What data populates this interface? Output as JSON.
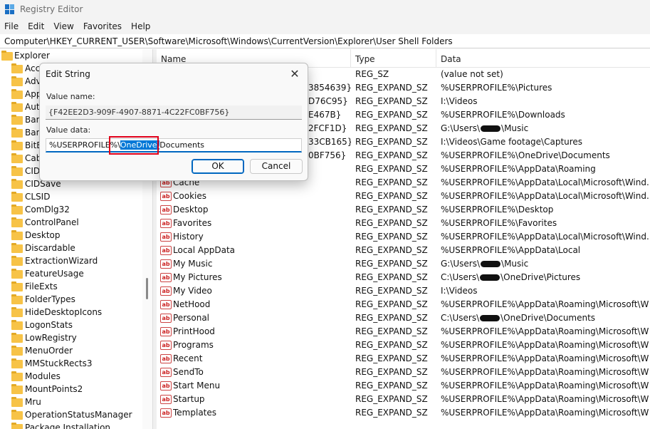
{
  "window": {
    "title": "Registry Editor"
  },
  "menu": [
    "File",
    "Edit",
    "View",
    "Favorites",
    "Help"
  ],
  "address": "Computer\\HKEY_CURRENT_USER\\Software\\Microsoft\\Windows\\CurrentVersion\\Explorer\\User Shell Folders",
  "tree": {
    "items": [
      {
        "label": "Explorer",
        "expanded": true
      },
      {
        "label": "Acc"
      },
      {
        "label": "Adv"
      },
      {
        "label": "App"
      },
      {
        "label": "Aut"
      },
      {
        "label": "Ban"
      },
      {
        "label": "Ban"
      },
      {
        "label": "BitB"
      },
      {
        "label": "Cab"
      },
      {
        "label": "CID"
      },
      {
        "label": "CIDSave"
      },
      {
        "label": "CLSID"
      },
      {
        "label": "ComDlg32"
      },
      {
        "label": "ControlPanel"
      },
      {
        "label": "Desktop"
      },
      {
        "label": "Discardable"
      },
      {
        "label": "ExtractionWizard"
      },
      {
        "label": "FeatureUsage"
      },
      {
        "label": "FileExts"
      },
      {
        "label": "FolderTypes"
      },
      {
        "label": "HideDesktopIcons"
      },
      {
        "label": "LogonStats"
      },
      {
        "label": "LowRegistry"
      },
      {
        "label": "MenuOrder"
      },
      {
        "label": "MMStuckRects3"
      },
      {
        "label": "Modules"
      },
      {
        "label": "MountPoints2"
      },
      {
        "label": "Mru"
      },
      {
        "label": "OperationStatusManager"
      },
      {
        "label": "Package Installation"
      }
    ]
  },
  "list": {
    "headers": {
      "name": "Name",
      "type": "Type",
      "data": "Data"
    },
    "rows": [
      {
        "name": "",
        "type": "REG_SZ",
        "data": "(value not set)"
      },
      {
        "name": "3854639}",
        "type": "REG_EXPAND_SZ",
        "data": "%USERPROFILE%\\Pictures"
      },
      {
        "name": "D76C95}",
        "type": "REG_EXPAND_SZ",
        "data": "I:\\Videos"
      },
      {
        "name": "E467B}",
        "type": "REG_EXPAND_SZ",
        "data": "%USERPROFILE%\\Downloads"
      },
      {
        "name": "2FCF1D}",
        "type": "REG_EXPAND_SZ",
        "data_pre": "G:\\Users\\",
        "data_post": "\\Music",
        "redacted": true
      },
      {
        "name": "33CB165}",
        "type": "REG_EXPAND_SZ",
        "data": "I:\\Videos\\Game footage\\Captures"
      },
      {
        "name": "0BF756}",
        "type": "REG_EXPAND_SZ",
        "data": "%USERPROFILE%\\OneDrive\\Documents"
      },
      {
        "name": "",
        "type": "REG_EXPAND_SZ",
        "data": "%USERPROFILE%\\AppData\\Roaming"
      },
      {
        "name": "Cache",
        "type": "REG_EXPAND_SZ",
        "data": "%USERPROFILE%\\AppData\\Local\\Microsoft\\Wind..."
      },
      {
        "name": "Cookies",
        "type": "REG_EXPAND_SZ",
        "data": "%USERPROFILE%\\AppData\\Local\\Microsoft\\Wind..."
      },
      {
        "name": "Desktop",
        "type": "REG_EXPAND_SZ",
        "data": "%USERPROFILE%\\Desktop"
      },
      {
        "name": "Favorites",
        "type": "REG_EXPAND_SZ",
        "data": "%USERPROFILE%\\Favorites"
      },
      {
        "name": "History",
        "type": "REG_EXPAND_SZ",
        "data": "%USERPROFILE%\\AppData\\Local\\Microsoft\\Wind..."
      },
      {
        "name": "Local AppData",
        "type": "REG_EXPAND_SZ",
        "data": "%USERPROFILE%\\AppData\\Local"
      },
      {
        "name": "My Music",
        "type": "REG_EXPAND_SZ",
        "data_pre": "G:\\Users\\",
        "data_post": "\\Music",
        "redacted": true
      },
      {
        "name": "My Pictures",
        "type": "REG_EXPAND_SZ",
        "data_pre": "C:\\Users\\",
        "data_post": "\\OneDrive\\Pictures",
        "redacted": true
      },
      {
        "name": "My Video",
        "type": "REG_EXPAND_SZ",
        "data": "I:\\Videos"
      },
      {
        "name": "NetHood",
        "type": "REG_EXPAND_SZ",
        "data": "%USERPROFILE%\\AppData\\Roaming\\Microsoft\\W..."
      },
      {
        "name": "Personal",
        "type": "REG_EXPAND_SZ",
        "data_pre": "C:\\Users\\",
        "data_post": "\\OneDrive\\Documents",
        "redacted": true
      },
      {
        "name": "PrintHood",
        "type": "REG_EXPAND_SZ",
        "data": "%USERPROFILE%\\AppData\\Roaming\\Microsoft\\W..."
      },
      {
        "name": "Programs",
        "type": "REG_EXPAND_SZ",
        "data": "%USERPROFILE%\\AppData\\Roaming\\Microsoft\\W..."
      },
      {
        "name": "Recent",
        "type": "REG_EXPAND_SZ",
        "data": "%USERPROFILE%\\AppData\\Roaming\\Microsoft\\W..."
      },
      {
        "name": "SendTo",
        "type": "REG_EXPAND_SZ",
        "data": "%USERPROFILE%\\AppData\\Roaming\\Microsoft\\W..."
      },
      {
        "name": "Start Menu",
        "type": "REG_EXPAND_SZ",
        "data": "%USERPROFILE%\\AppData\\Roaming\\Microsoft\\W..."
      },
      {
        "name": "Startup",
        "type": "REG_EXPAND_SZ",
        "data": "%USERPROFILE%\\AppData\\Roaming\\Microsoft\\W..."
      },
      {
        "name": "Templates",
        "type": "REG_EXPAND_SZ",
        "data": "%USERPROFILE%\\AppData\\Roaming\\Microsoft\\W..."
      }
    ]
  },
  "dialog": {
    "title": "Edit String",
    "value_name_label": "Value name:",
    "value_name": "{F42EE2D3-909F-4907-8871-4C22FC0BF756}",
    "value_data_label": "Value data:",
    "value_data_before": "%USERPROFILE%\\",
    "value_data_selected": "OneDrive\\",
    "value_data_after": "Documents",
    "ok_label": "OK",
    "cancel_label": "Cancel",
    "close_glyph": "✕"
  },
  "colors": {
    "accent": "#0067c0",
    "selection": "#0078d7",
    "annotation": "#e0001a",
    "folder": "#f7c347"
  }
}
